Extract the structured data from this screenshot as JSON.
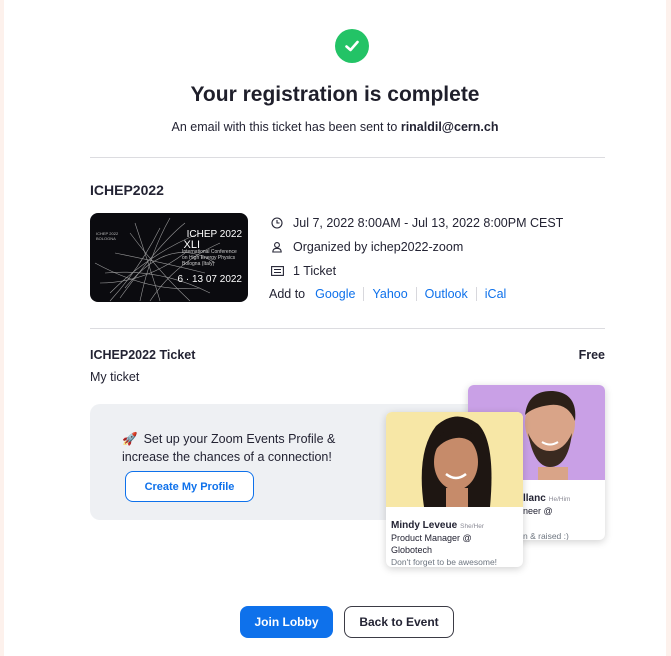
{
  "header": {
    "title": "Your registration is complete",
    "email_prefix": "An email with this ticket has been sent to ",
    "email": "rinaldil@cern.ch"
  },
  "event": {
    "name": "ICHEP2022",
    "thumbnail": {
      "brand_small": "ICHEP 2022\nBOLOGNA",
      "heading": "ICHEP 2022",
      "roman": "XLI",
      "subtitle": "International Conference\non High Energy Physics\nBologna (Italy)",
      "dates": "6 · 13 07 2022"
    },
    "date": "Jul 7, 2022 8:00AM - Jul 13, 2022 8:00PM CEST",
    "organizer": "Organized by ichep2022-zoom",
    "tickets": "1 Ticket",
    "add_to_label": "Add to",
    "calendars": [
      "Google",
      "Yahoo",
      "Outlook",
      "iCal"
    ]
  },
  "ticket": {
    "name": "ICHEP2022 Ticket",
    "price": "Free",
    "description": "My ticket"
  },
  "promo": {
    "emoji": "🚀",
    "text": "Set up your Zoom Events Profile & increase the chances of a connection!",
    "button": "Create My Profile",
    "front_card": {
      "name": "Mindy Leveue",
      "pronouns": "She/Her",
      "role": "Product Manager @ Globotech",
      "quote": "Don't forget to be awesome!"
    },
    "back_card": {
      "name_fragment": "llanc",
      "pronouns": "He/Him",
      "role_fragment": "neer @",
      "quote_fragment": "n & raised :)"
    }
  },
  "actions": {
    "join": "Join Lobby",
    "back": "Back to Event"
  },
  "colors": {
    "accent": "#0e71eb",
    "success": "#23c366",
    "page_bg": "#fdf1ec"
  }
}
